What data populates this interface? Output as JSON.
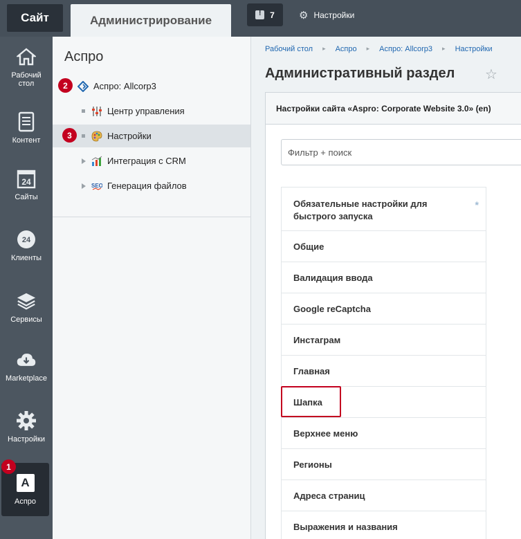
{
  "topbar": {
    "site_tab": "Сайт",
    "admin_tab": "Администрирование",
    "notifications_count": "7",
    "settings_label": "Настройки"
  },
  "leftmenu": {
    "items": [
      {
        "label": "Рабочий стол",
        "icon": "home-icon"
      },
      {
        "label": "Контент",
        "icon": "document-icon"
      },
      {
        "label": "Сайты",
        "icon": "calendar-24-icon"
      },
      {
        "label": "Клиенты",
        "icon": "clients-24-icon"
      },
      {
        "label": "Сервисы",
        "icon": "layers-icon"
      },
      {
        "label": "Marketplace",
        "icon": "cloud-download-icon"
      },
      {
        "label": "Настройки",
        "icon": "gear-icon"
      }
    ],
    "active": {
      "label": "Аспро",
      "glyph": "A"
    }
  },
  "badges": {
    "b1": "1",
    "b2": "2",
    "b3": "3"
  },
  "panel": {
    "title": "Аспро",
    "tree": [
      {
        "label": "Аспро: Allcorp3",
        "icon": "aspro-logo-icon"
      },
      {
        "label": "Центр управления",
        "icon": "sliders-icon"
      },
      {
        "label": "Настройки",
        "icon": "palette-icon"
      },
      {
        "label": "Интеграция с CRM",
        "icon": "chart-icon"
      },
      {
        "label": "Генерация файлов",
        "icon": "seo-icon"
      }
    ]
  },
  "breadcrumb": [
    "Рабочий стол",
    "Аспро",
    "Аспро: Allcorp3",
    "Настройки"
  ],
  "page": {
    "title": "Административный раздел",
    "context_tab": "Настройки сайта «Aspro: Corporate Website 3.0» (en)",
    "filter_placeholder": "Фильтр + поиск"
  },
  "settings_list": [
    "Обязательные настройки для быстрого запуска",
    "Общие",
    "Валидация ввода",
    "Google reCaptcha",
    "Инстаграм",
    "Главная",
    "Шапка",
    "Верхнее меню",
    "Регионы",
    "Адреса страниц",
    "Выражения и названия"
  ],
  "colors": {
    "accent": "#c3001f",
    "link": "#2067b0",
    "menu_bg": "#4c5660"
  }
}
